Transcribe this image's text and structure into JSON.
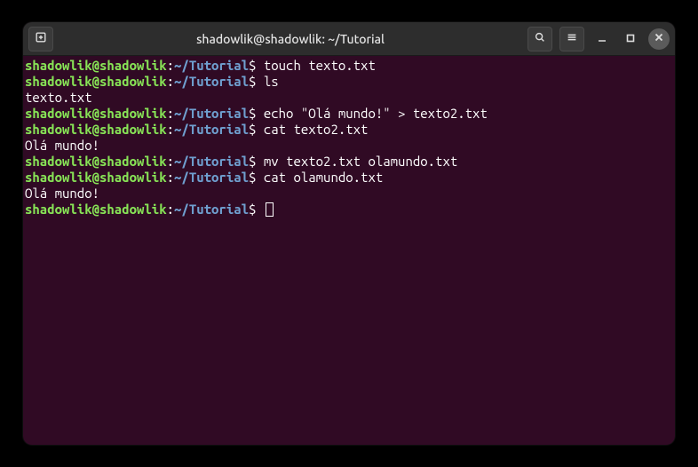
{
  "window": {
    "title": "shadowlik@shadowlik: ~/Tutorial"
  },
  "prompt": {
    "user_host": "shadowlik@shadowlik",
    "separator": ":",
    "path": "~/Tutorial",
    "symbol": "$"
  },
  "lines": [
    {
      "type": "prompt",
      "cmd": " touch texto.txt"
    },
    {
      "type": "prompt",
      "cmd": " ls"
    },
    {
      "type": "output",
      "text": "texto.txt"
    },
    {
      "type": "prompt",
      "cmd": " echo \"Olá mundo!\" > texto2.txt"
    },
    {
      "type": "prompt",
      "cmd": " cat texto2.txt"
    },
    {
      "type": "output",
      "text": "Olá mundo!"
    },
    {
      "type": "prompt",
      "cmd": " mv texto2.txt olamundo.txt"
    },
    {
      "type": "prompt",
      "cmd": " cat olamundo.txt"
    },
    {
      "type": "output",
      "text": "Olá mundo!"
    },
    {
      "type": "prompt",
      "cmd": " ",
      "cursor": true
    }
  ],
  "icons": {
    "new_tab": "new-tab-icon",
    "search": "search-icon",
    "menu": "menu-icon",
    "minimize": "minimize-icon",
    "maximize": "maximize-icon",
    "close": "close-icon"
  }
}
